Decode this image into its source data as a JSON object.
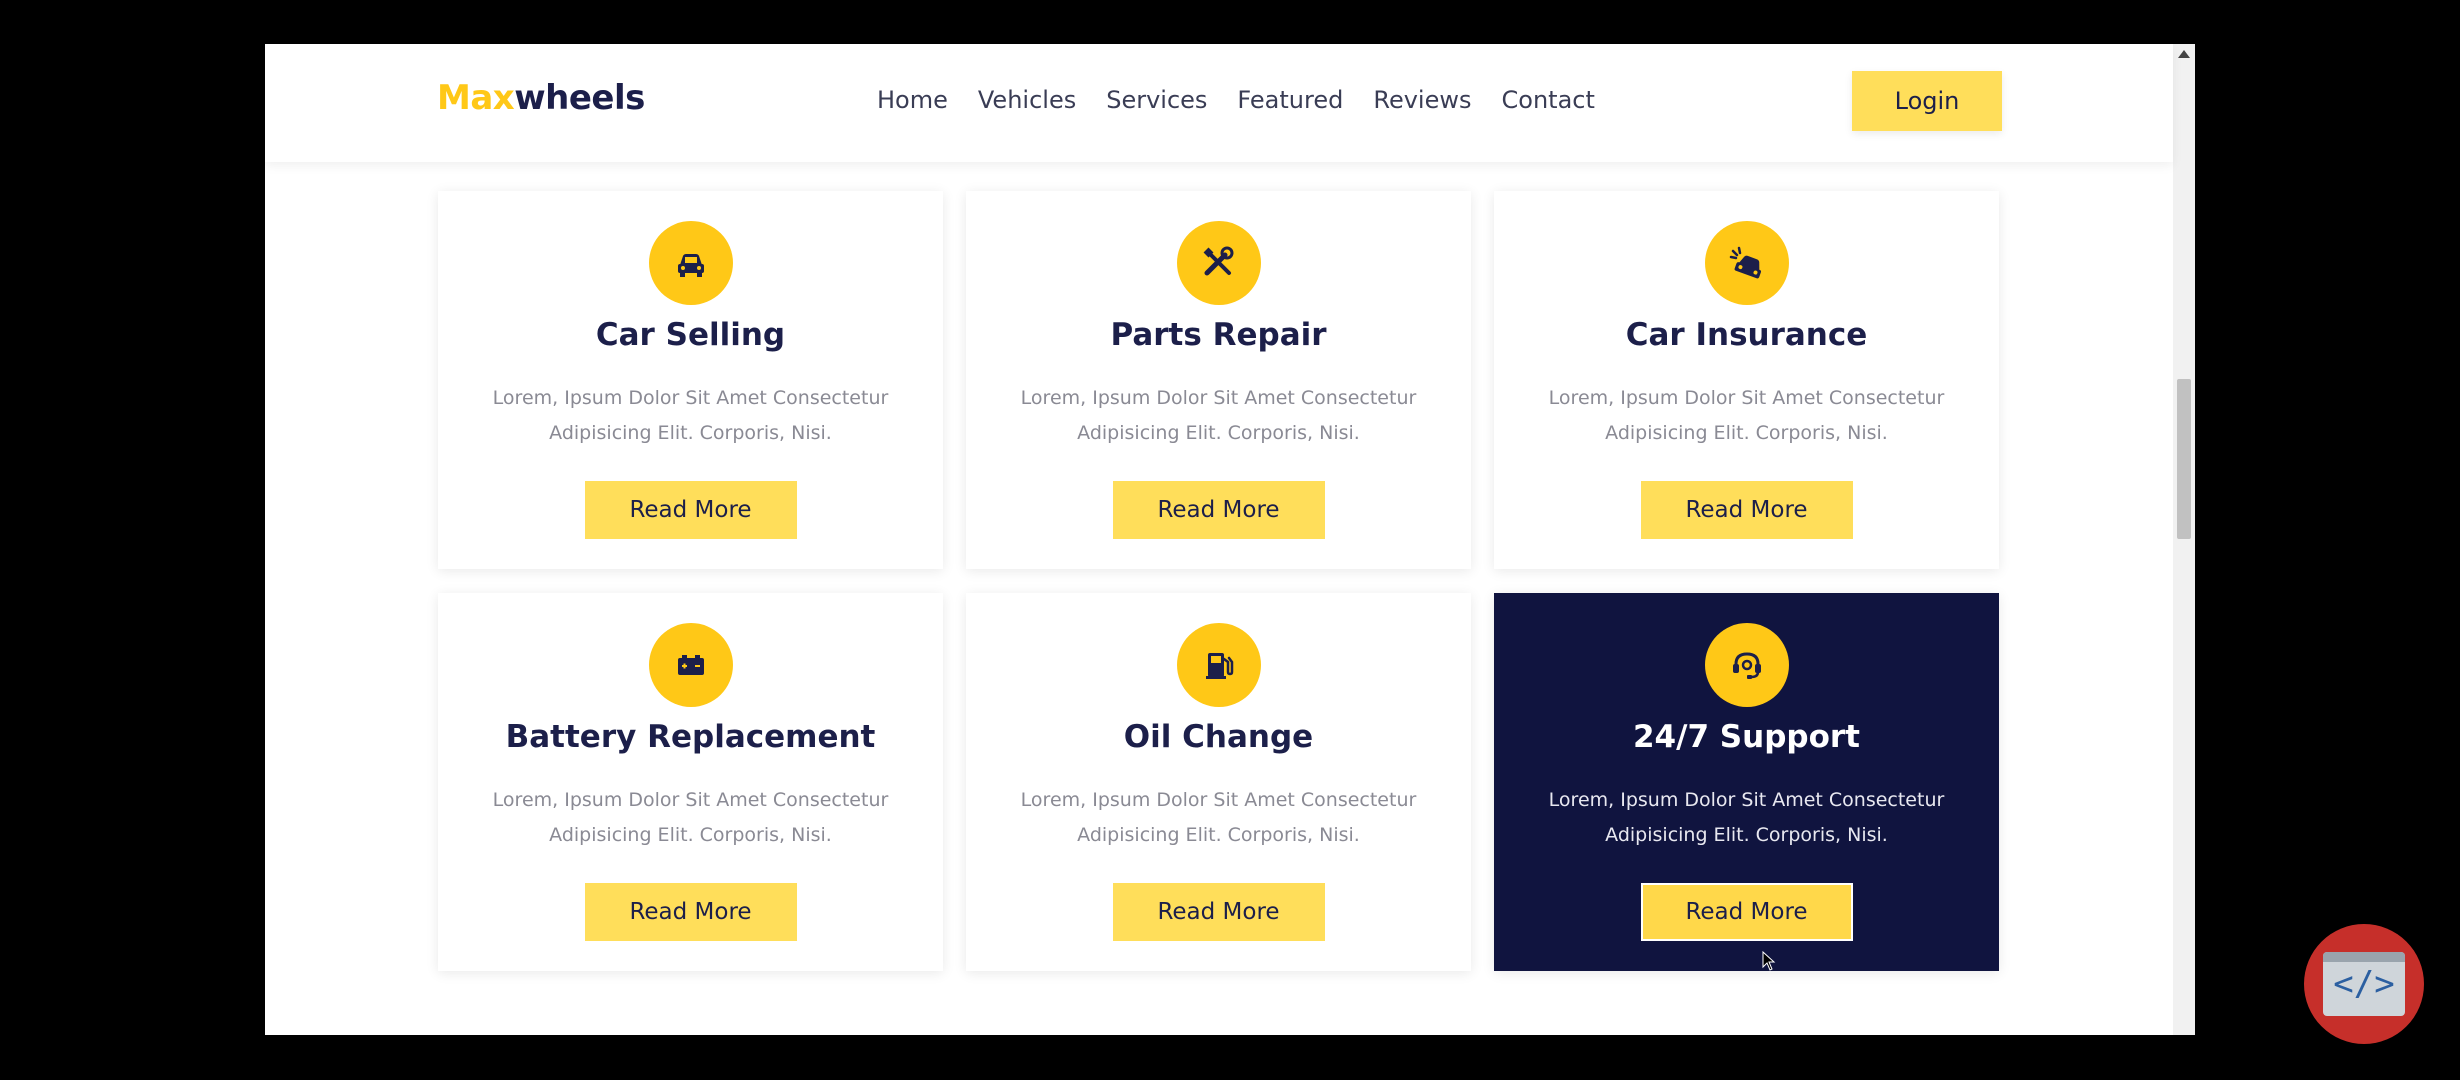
{
  "navbar": {
    "logo_accent": "Max",
    "logo_rest": "wheels",
    "links": [
      "Home",
      "Vehicles",
      "Services",
      "Featured",
      "Reviews",
      "Contact"
    ],
    "login_label": "Login"
  },
  "services": [
    {
      "title": "Car Selling",
      "desc": "Lorem, Ipsum Dolor Sit Amet Consectetur Adipisicing Elit. Corporis, Nisi.",
      "button": "Read More",
      "icon": "car-icon"
    },
    {
      "title": "Parts Repair",
      "desc": "Lorem, Ipsum Dolor Sit Amet Consectetur Adipisicing Elit. Corporis, Nisi.",
      "button": "Read More",
      "icon": "tools-icon"
    },
    {
      "title": "Car Insurance",
      "desc": "Lorem, Ipsum Dolor Sit Amet Consectetur Adipisicing Elit. Corporis, Nisi.",
      "button": "Read More",
      "icon": "car-crash-icon"
    },
    {
      "title": "Battery Replacement",
      "desc": "Lorem, Ipsum Dolor Sit Amet Consectetur Adipisicing Elit. Corporis, Nisi.",
      "button": "Read More",
      "icon": "car-battery-icon"
    },
    {
      "title": "Oil Change",
      "desc": "Lorem, Ipsum Dolor Sit Amet Consectetur Adipisicing Elit. Corporis, Nisi.",
      "button": "Read More",
      "icon": "gas-pump-icon"
    },
    {
      "title": "24/7 Support",
      "desc": "Lorem, Ipsum Dolor Sit Amet Consectetur Adipisicing Elit. Corporis, Nisi.",
      "button": "Read More",
      "icon": "headset-icon"
    }
  ],
  "colors": {
    "accent": "#ffc817",
    "button": "#ffde5a",
    "dark": "#10143f",
    "badge": "#c62f2a"
  }
}
